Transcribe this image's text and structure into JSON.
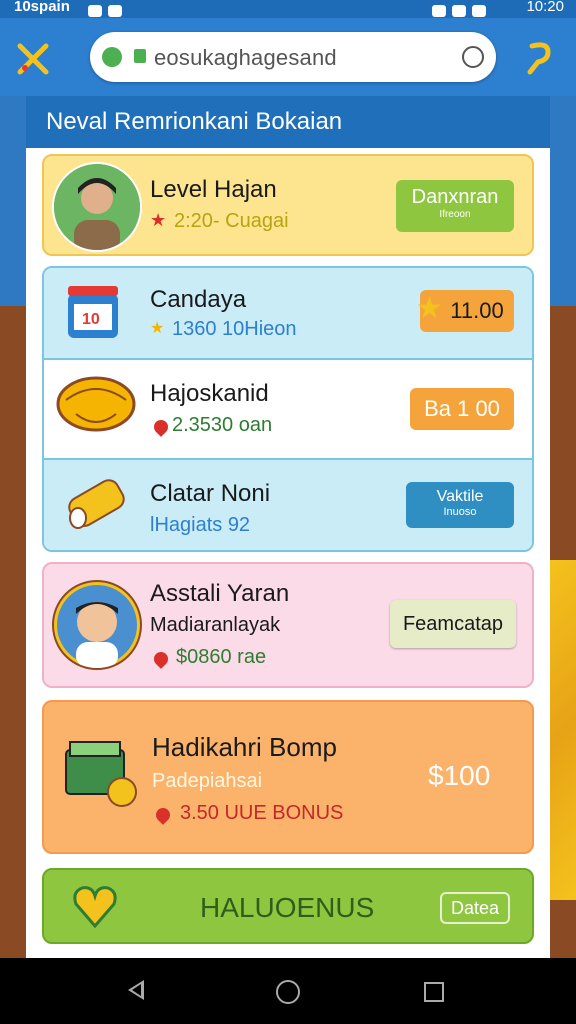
{
  "status_bar": {
    "carrier": "10spain",
    "time": "10:20"
  },
  "browser": {
    "url": "eosukaghagesand"
  },
  "panel": {
    "title": "Neval Remrionkani Bokaian"
  },
  "cards": [
    {
      "title": "Level Hajan",
      "sub": "2:20- Cuagai",
      "btn_label": "Danxnran",
      "btn_sub": "Ifreoon"
    },
    {
      "title": "Candaya",
      "sub": "1360 10Hieon",
      "btn_label": "11.00"
    },
    {
      "title": "Hajoskanid",
      "sub": "2.3530 oan",
      "btn_label": "Ba 1 00"
    },
    {
      "title": "Clatar Noni",
      "sub": "lHagiats 92",
      "btn_label": "Vaktile",
      "btn_sub": "Inuoso"
    },
    {
      "title": "Asstali Yaran",
      "sub1": "Madiaranlayak",
      "sub2": "$0860 rae",
      "btn_label": "Feamcatap"
    },
    {
      "title": "Hadikahri Bomp",
      "sub1": "Padepiahsai",
      "sub2": "3.50 UUE BONUS",
      "price": "$100"
    },
    {
      "title": "HALUOENUS",
      "btn_label": "Datea"
    }
  ],
  "colors": {
    "header_blue": "#1f6fba",
    "yellow_card": "#fde58f",
    "blue_row": "#c9ecf6",
    "pink_card": "#fbdbe7",
    "orange_card": "#fbb36c",
    "green_card": "#8ec63f"
  }
}
